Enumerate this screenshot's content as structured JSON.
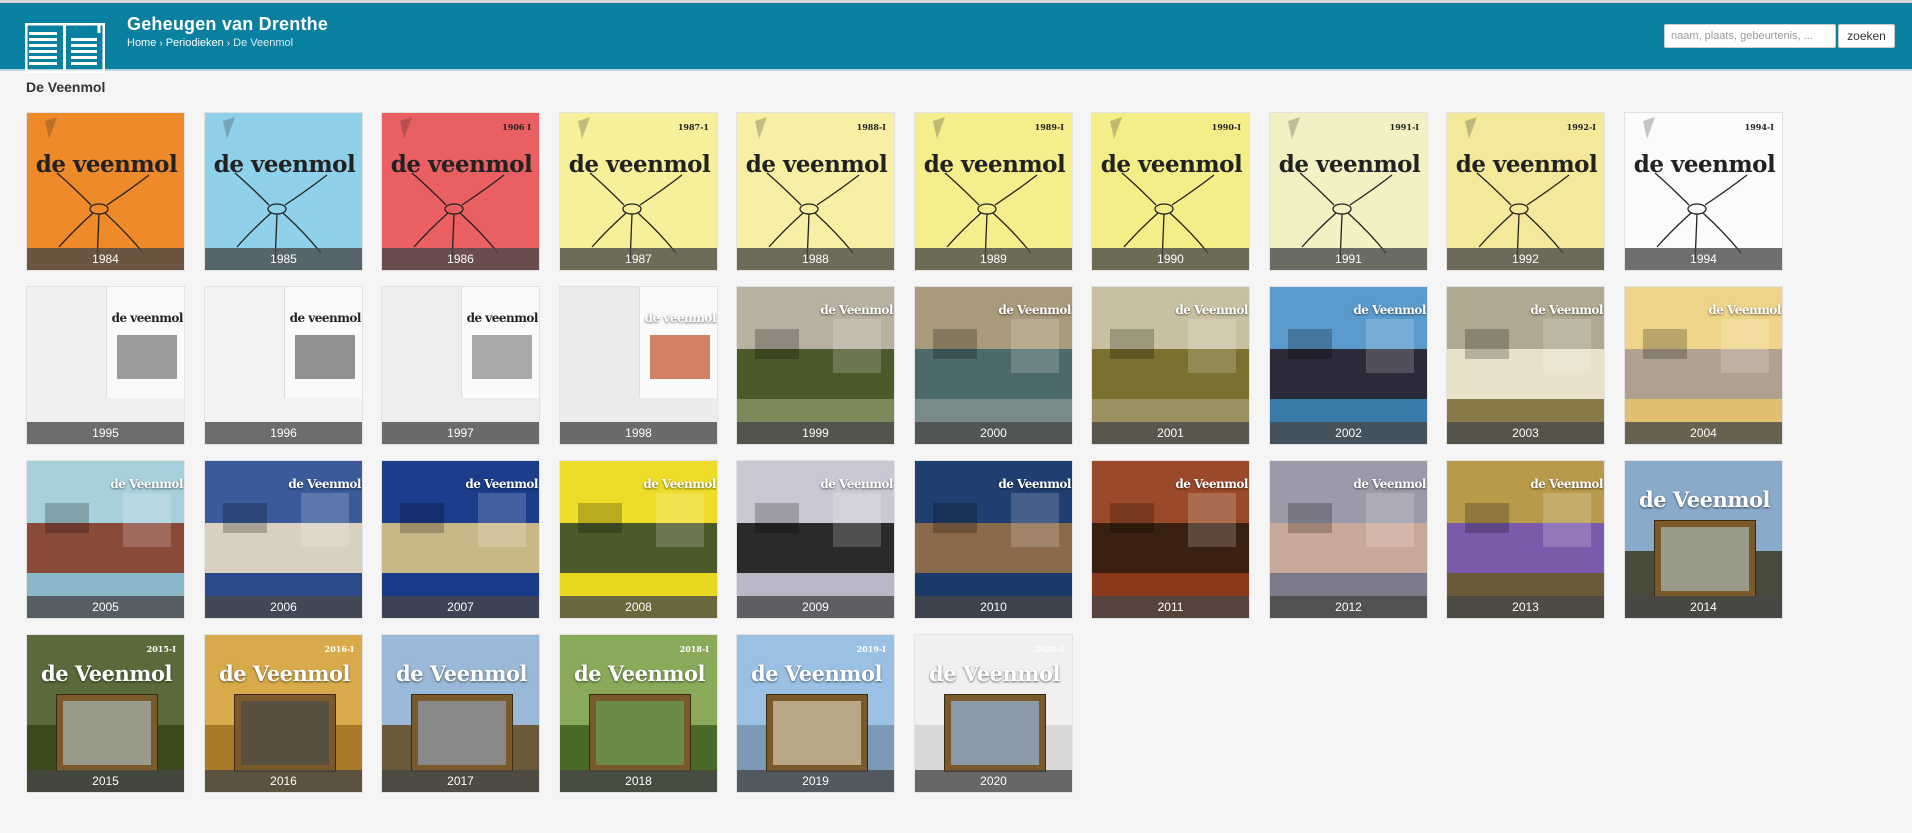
{
  "header": {
    "site_title": "Geheugen van Drenthe",
    "breadcrumb": [
      {
        "label": "Home"
      },
      {
        "label": "Periodieken"
      },
      {
        "label": "De Veenmol"
      }
    ],
    "search": {
      "placeholder": "naam, plaats, gebeurtenis, ...",
      "button_label": "zoeken"
    }
  },
  "page": {
    "title": "De Veenmol"
  },
  "colors": {
    "header": "#0a80a0",
    "label_bar": "#4a4a4a",
    "background": "#f5f5f5"
  },
  "issues": [
    {
      "year": "1984",
      "cover": {
        "style": "classic",
        "bg": "#ee8a2a",
        "title": "de veenmol"
      }
    },
    {
      "year": "1985",
      "cover": {
        "style": "classic",
        "bg": "#8fd0ea",
        "title": "de veenmol"
      }
    },
    {
      "year": "1986",
      "cover": {
        "style": "classic",
        "bg": "#ea5f62",
        "title": "de veenmol",
        "issue": "1906 I"
      }
    },
    {
      "year": "1987",
      "cover": {
        "style": "classic",
        "bg": "#f6f09a",
        "title": "de veenmol",
        "issue": "1987-1"
      }
    },
    {
      "year": "1988",
      "cover": {
        "style": "classic",
        "bg": "#f7f0a4",
        "title": "de veenmol",
        "issue": "1988-I"
      }
    },
    {
      "year": "1989",
      "cover": {
        "style": "classic",
        "bg": "#f5ee8c",
        "title": "de veenmol",
        "issue": "1989-I"
      }
    },
    {
      "year": "1990",
      "cover": {
        "style": "classic",
        "bg": "#f4ee88",
        "title": "de veenmol",
        "issue": "1990-I"
      }
    },
    {
      "year": "1991",
      "cover": {
        "style": "classic",
        "bg": "#f3f0c4",
        "title": "de veenmol",
        "issue": "1991-I"
      }
    },
    {
      "year": "1992",
      "cover": {
        "style": "classic",
        "bg": "#f4e99a",
        "title": "de veenmol",
        "issue": "1992-I"
      }
    },
    {
      "year": "1994",
      "cover": {
        "style": "classic",
        "bg": "#fbfbfb",
        "title": "de veenmol",
        "issue": "1994-I"
      }
    },
    {
      "year": "1995",
      "cover": {
        "style": "spread",
        "bg": "#f0f0f0",
        "title": "de veenmol",
        "photo": "#8a8a8a"
      }
    },
    {
      "year": "1996",
      "cover": {
        "style": "spread",
        "bg": "#f3f3f3",
        "title": "de veenmol",
        "photo": "#7e7e7e"
      }
    },
    {
      "year": "1997",
      "cover": {
        "style": "spread",
        "bg": "#eeeeee",
        "title": "de veenmol",
        "photo": "#9a9a9a"
      }
    },
    {
      "year": "1998",
      "cover": {
        "style": "spread",
        "bg": "#ececec",
        "title": "de veenmol",
        "photo": "#c86a4a",
        "title_light": true
      }
    },
    {
      "year": "1999",
      "cover": {
        "style": "photo",
        "bg": "#7c8a5a",
        "title": "de Veenmol",
        "sky": "#b8b0a0",
        "ground": "#4a5a2a"
      }
    },
    {
      "year": "2000",
      "cover": {
        "style": "photo",
        "bg": "#7a8a8a",
        "title": "de Veenmol",
        "sky": "#a89a7a",
        "ground": "#4c6a6c"
      }
    },
    {
      "year": "2001",
      "cover": {
        "style": "photo",
        "bg": "#9a9060",
        "title": "de Veenmol",
        "sky": "#c8c0a0",
        "ground": "#7a7030"
      }
    },
    {
      "year": "2002",
      "cover": {
        "style": "photo",
        "bg": "#3a7aaa",
        "title": "de Veenmol",
        "sky": "#5a9acc",
        "ground": "#2a2a3a"
      }
    },
    {
      "year": "2003",
      "cover": {
        "style": "photo",
        "bg": "#8a7a4a",
        "title": "de Veenmol",
        "sky": "#b0a890",
        "ground": "#e8e0c8"
      }
    },
    {
      "year": "2004",
      "cover": {
        "style": "photo",
        "bg": "#e0c070",
        "title": "de Veenmol",
        "sky": "#eed488",
        "ground": "#b0a090"
      }
    },
    {
      "year": "2005",
      "cover": {
        "style": "photo",
        "bg": "#8ab8c8",
        "title": "de Veenmol",
        "sky": "#a8d0dc",
        "ground": "#8a4a3a"
      }
    },
    {
      "year": "2006",
      "cover": {
        "style": "photo",
        "bg": "#2a4a8a",
        "title": "de Veenmol",
        "sky": "#3a5a9a",
        "ground": "#d8d0c0"
      }
    },
    {
      "year": "2007",
      "cover": {
        "style": "photo",
        "bg": "#1a3a8a",
        "title": "de Veenmol",
        "sky": "#1c3c8c",
        "ground": "#c8b888"
      }
    },
    {
      "year": "2008",
      "cover": {
        "style": "photo",
        "bg": "#e8d820",
        "title": "de Veenmol",
        "sky": "#eedc28",
        "ground": "#4a5a2a"
      }
    },
    {
      "year": "2009",
      "cover": {
        "style": "photo",
        "bg": "#b8b8c8",
        "title": "de Veenmol",
        "sky": "#c8c8d4",
        "ground": "#2a2a2a"
      }
    },
    {
      "year": "2010",
      "cover": {
        "style": "photo",
        "bg": "#1a3a6a",
        "title": "de Veenmol",
        "sky": "#203e70",
        "ground": "#8a6a4a"
      }
    },
    {
      "year": "2011",
      "cover": {
        "style": "photo",
        "bg": "#8a3a1a",
        "title": "de Veenmol",
        "sky": "#9a4a2a",
        "ground": "#3a2010"
      }
    },
    {
      "year": "2012",
      "cover": {
        "style": "photo",
        "bg": "#7a7a8a",
        "title": "de Veenmol",
        "sky": "#9a9aaa",
        "ground": "#c8a898"
      }
    },
    {
      "year": "2013",
      "cover": {
        "style": "photo",
        "bg": "#6a5a3a",
        "title": "de Veenmol",
        "sky": "#b89a4a",
        "ground": "#7a5aaa"
      }
    },
    {
      "year": "2014",
      "cover": {
        "style": "framed",
        "bg": "#3a5a7a",
        "title": "de Veenmol",
        "sky": "#8aaacc",
        "ground": "#4a4a3a",
        "photo": "#9a9a8a"
      }
    },
    {
      "year": "2015",
      "cover": {
        "style": "framed",
        "bg": "#4a5a2a",
        "title": "de Veenmol",
        "sky": "#5a6a3a",
        "ground": "#3a4a1a",
        "photo": "#9a9a8a",
        "issue": "2015-I"
      }
    },
    {
      "year": "2016",
      "cover": {
        "style": "framed",
        "bg": "#c89a3a",
        "title": "de Veenmol",
        "sky": "#d8aa4a",
        "ground": "#a87a2a",
        "photo": "#5a5040",
        "issue": "2016-I"
      }
    },
    {
      "year": "2017",
      "cover": {
        "style": "framed",
        "bg": "#5a7a9a",
        "title": "de Veenmol",
        "sky": "#9ab8d8",
        "ground": "#6a5a3a",
        "photo": "#8a8a88"
      }
    },
    {
      "year": "2018",
      "cover": {
        "style": "framed",
        "bg": "#5a7a3a",
        "title": "de Veenmol",
        "sky": "#8aaa5a",
        "ground": "#4a6a2a",
        "photo": "#6a8a4a",
        "issue": "2018-I"
      }
    },
    {
      "year": "2019",
      "cover": {
        "style": "framed",
        "bg": "#8ab0d8",
        "title": "de Veenmol",
        "sky": "#9ac0e4",
        "ground": "#7a9ab8",
        "photo": "#b8a888",
        "issue": "2019-I"
      }
    },
    {
      "year": "2020",
      "cover": {
        "style": "framed",
        "bg": "#e8e8e8",
        "title": "de Veenmol",
        "sky": "#f0f0f0",
        "ground": "#d8d8d8",
        "photo": "#8a9aa8",
        "issue": "2020-I"
      }
    }
  ]
}
